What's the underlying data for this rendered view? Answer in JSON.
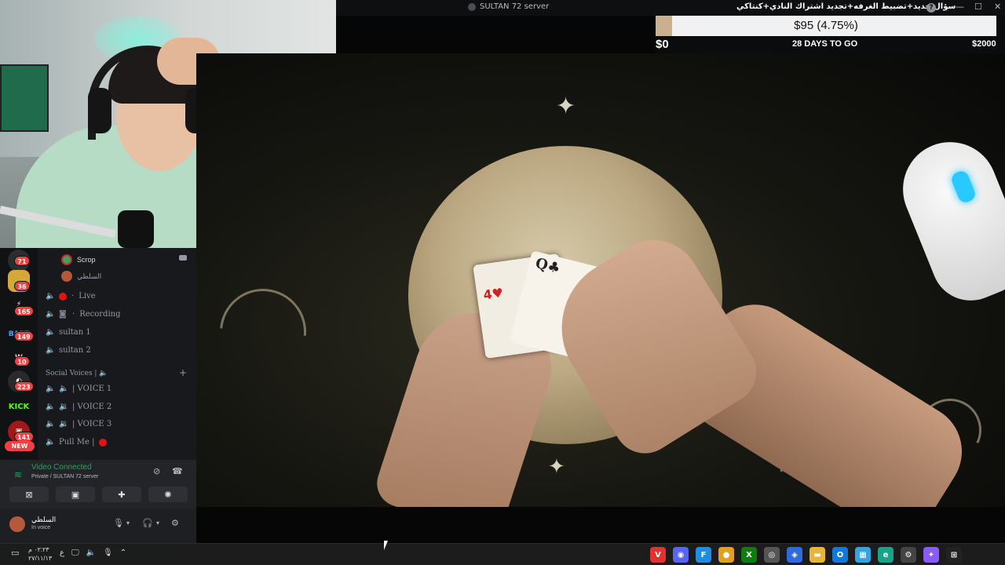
{
  "titlebar": {
    "title": "SULTAN 72 server",
    "overlay_text": "سؤال جديد+تضبيط الغرفه+تجديد اشتراك النادي+كنتاكي",
    "help": "?",
    "minimize": "—",
    "maximize": "☐",
    "close": "✕"
  },
  "goal": {
    "current": "$95 (4.75%)",
    "progress_percent": 4.75,
    "start": "$0",
    "days_left": "28 DAYS TO GO",
    "target": "$2000"
  },
  "colors": {
    "accent_green": "#23a55a",
    "badge_red": "#f23f43",
    "goal_fill": "#c9b190"
  },
  "servers": [
    {
      "label": "",
      "badge": "71"
    },
    {
      "label": "",
      "badge": "36"
    },
    {
      "label": "⚡",
      "badge": "165"
    },
    {
      "label": "BART",
      "badge": "149"
    },
    {
      "label": "W",
      "badge": "10"
    },
    {
      "label": "◐",
      "badge": "223"
    },
    {
      "label": "KICK",
      "badge": ""
    },
    {
      "label": "▣",
      "badge": "141"
    }
  ],
  "new_badge": "NEW",
  "channels": {
    "voice_user_1": "Scrop",
    "voice_user_2": "السلطي",
    "live": "Live",
    "recording": "Recording",
    "sultan1": "sultan 1",
    "sultan2": "sultan 2",
    "category": "Social Voices | 🔈",
    "voice1": "| VOICE 1",
    "voice2": "| VOICE 2",
    "voice3": "| VOICE 3",
    "pullme": "Pull Me |"
  },
  "voice_panel": {
    "status": "Video Connected",
    "location": "Private / SULTAN 72 server"
  },
  "user": {
    "name": "السلطي",
    "status": "In voice"
  },
  "taskbar": {
    "time": "٠٢:٢٣ م",
    "date": "٢٧/١١/١٣",
    "lang": "ع",
    "apps": [
      {
        "name": "vivaldi-icon",
        "glyph": "V",
        "color": "#e0332f"
      },
      {
        "name": "discord-icon",
        "glyph": "◉",
        "color": "#5865f2"
      },
      {
        "name": "files-icon",
        "glyph": "F",
        "color": "#1f8ee0"
      },
      {
        "name": "chrome-icon",
        "glyph": "●",
        "color": "#e0a020"
      },
      {
        "name": "xbox-icon",
        "glyph": "X",
        "color": "#107c10"
      },
      {
        "name": "obs-icon",
        "glyph": "◎",
        "color": "#555555"
      },
      {
        "name": "app-blue-icon",
        "glyph": "◈",
        "color": "#2f6bdc"
      },
      {
        "name": "folder-icon",
        "glyph": "▬",
        "color": "#e8b53a"
      },
      {
        "name": "outlook-icon",
        "glyph": "O",
        "color": "#1479d6"
      },
      {
        "name": "store-icon",
        "glyph": "▦",
        "color": "#36a2e0"
      },
      {
        "name": "edge-icon",
        "glyph": "e",
        "color": "#18a38a"
      },
      {
        "name": "settings-icon",
        "glyph": "⚙",
        "color": "#444444"
      },
      {
        "name": "copilot-icon",
        "glyph": "✦",
        "color": "#8a5cf6"
      },
      {
        "name": "windows-icon",
        "glyph": "⊞",
        "color": "#222222"
      }
    ]
  }
}
